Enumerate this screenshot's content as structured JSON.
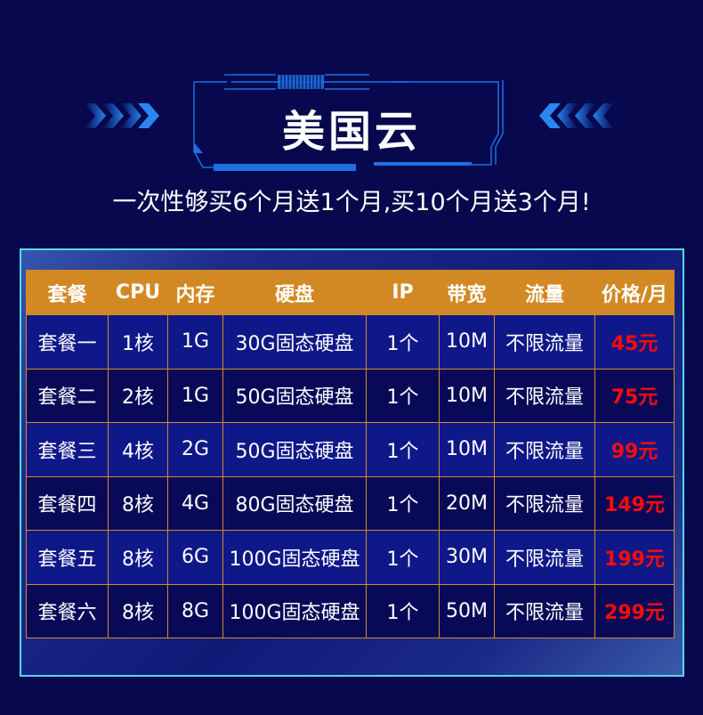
{
  "header": {
    "title": "美国云",
    "subtitle": "一次性够买6个月送1个月,买10个月送3个月!",
    "decor_left_icon": "chevrons-right-icon",
    "decor_right_icon": "chevrons-left-icon"
  },
  "colors": {
    "background": "#07084d",
    "header_row": "#d38923",
    "grid_line": "#d4892a",
    "price": "#ff0a0a",
    "panel_border": "#55d8f0",
    "accent_blue": "#1e6fe0"
  },
  "table": {
    "headers": [
      "套餐",
      "CPU",
      "内存",
      "硬盘",
      "IP",
      "带宽",
      "流量",
      "价格/月"
    ],
    "rows": [
      {
        "plan": "套餐一",
        "cpu": "1核",
        "ram": "1G",
        "disk": "30G固态硬盘",
        "ip": "1个",
        "bandwidth": "10M",
        "traffic": "不限流量",
        "price": "45元"
      },
      {
        "plan": "套餐二",
        "cpu": "2核",
        "ram": "1G",
        "disk": "50G固态硬盘",
        "ip": "1个",
        "bandwidth": "10M",
        "traffic": "不限流量",
        "price": "75元"
      },
      {
        "plan": "套餐三",
        "cpu": "4核",
        "ram": "2G",
        "disk": "50G固态硬盘",
        "ip": "1个",
        "bandwidth": "10M",
        "traffic": "不限流量",
        "price": "99元"
      },
      {
        "plan": "套餐四",
        "cpu": "8核",
        "ram": "4G",
        "disk": "80G固态硬盘",
        "ip": "1个",
        "bandwidth": "20M",
        "traffic": "不限流量",
        "price": "149元"
      },
      {
        "plan": "套餐五",
        "cpu": "8核",
        "ram": "6G",
        "disk": "100G固态硬盘",
        "ip": "1个",
        "bandwidth": "30M",
        "traffic": "不限流量",
        "price": "199元"
      },
      {
        "plan": "套餐六",
        "cpu": "8核",
        "ram": "8G",
        "disk": "100G固态硬盘",
        "ip": "1个",
        "bandwidth": "50M",
        "traffic": "不限流量",
        "price": "299元"
      }
    ]
  }
}
